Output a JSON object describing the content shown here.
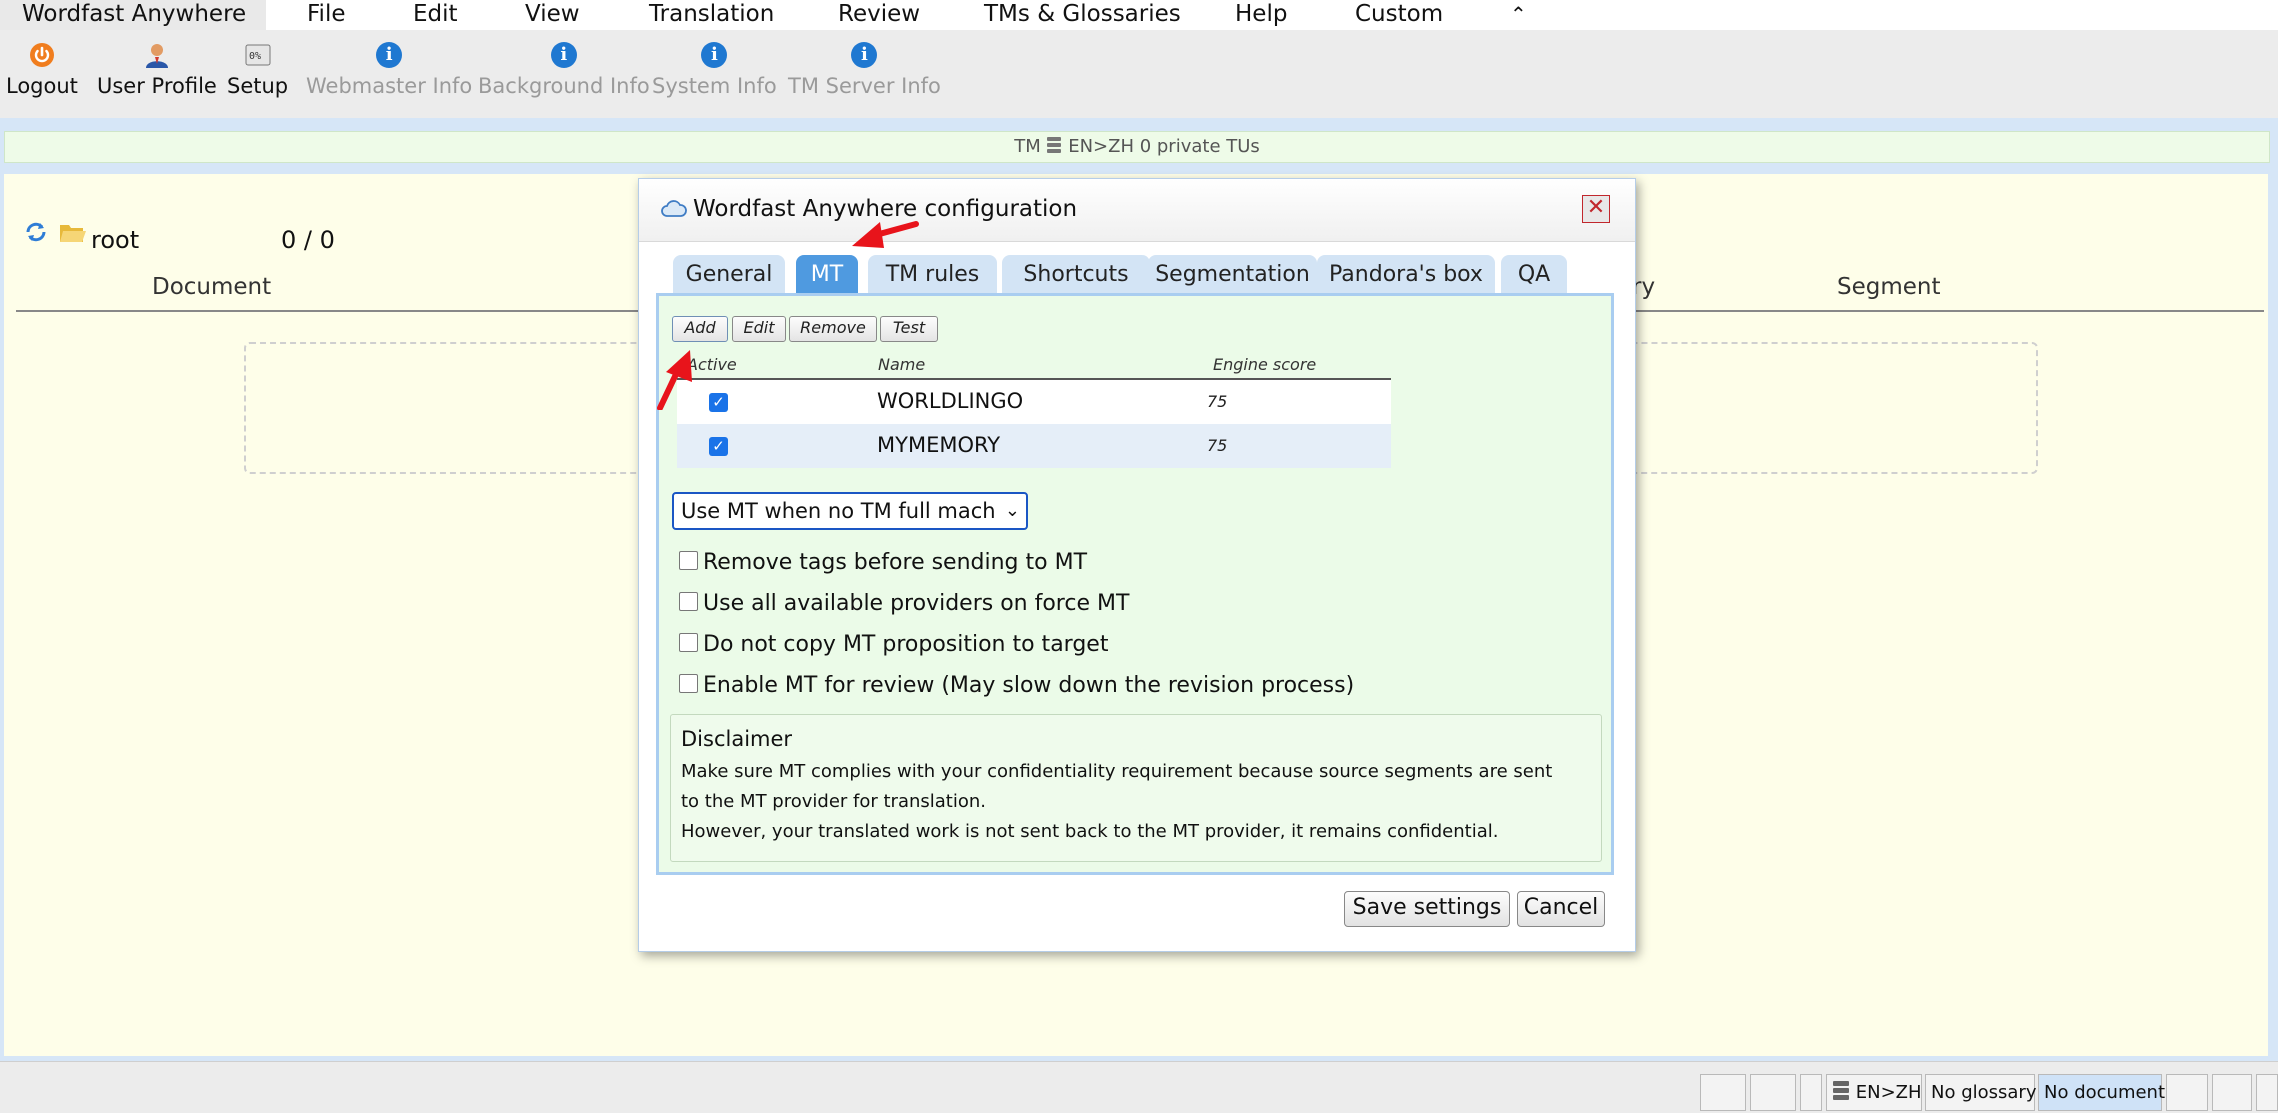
{
  "menubar": {
    "app_name": "Wordfast Anywhere",
    "items": [
      "File",
      "Edit",
      "View",
      "Translation",
      "Review",
      "TMs & Glossaries",
      "Help",
      "Custom"
    ],
    "collapse_icon": "double-chevron-up-icon"
  },
  "toolbar": {
    "items": [
      {
        "label": "Logout",
        "icon": "power-icon",
        "enabled": true
      },
      {
        "label": "User Profile",
        "icon": "user-icon",
        "enabled": true
      },
      {
        "label": "Setup",
        "icon": "setup-icon",
        "enabled": true
      },
      {
        "label": "Webmaster Info",
        "icon": "info-icon",
        "enabled": false
      },
      {
        "label": "Background Info",
        "icon": "info-icon",
        "enabled": false
      },
      {
        "label": "System Info",
        "icon": "info-icon",
        "enabled": false
      },
      {
        "label": "TM Server Info",
        "icon": "info-icon",
        "enabled": false
      }
    ]
  },
  "tmbar": {
    "prefix": "TM",
    "text": "EN>ZH 0 private TUs"
  },
  "main": {
    "root_label": "root",
    "counter": "0 / 0",
    "columns": {
      "document": "Document",
      "glossary_partial": "ry",
      "segment": "Segment"
    }
  },
  "statusbar": {
    "lang": "EN>ZH",
    "glossary": "No glossary",
    "document": "No document"
  },
  "dialog": {
    "title": "Wordfast Anywhere configuration",
    "tabs": [
      "General",
      "MT",
      "TM rules",
      "Shortcuts",
      "Segmentation",
      "Pandora's box",
      "QA"
    ],
    "active_tab": "MT",
    "mt": {
      "buttons": {
        "add": "Add",
        "edit": "Edit",
        "remove": "Remove",
        "test": "Test"
      },
      "table": {
        "headers": {
          "active": "Active",
          "name": "Name",
          "score": "Engine score"
        },
        "rows": [
          {
            "active": true,
            "name": "WORLDLINGO",
            "score": "75"
          },
          {
            "active": true,
            "name": "MYMEMORY",
            "score": "75"
          }
        ]
      },
      "mode_select": "Use MT when no TM full mach",
      "options": [
        {
          "label": "Remove tags before sending to MT",
          "checked": false
        },
        {
          "label": "Use all available providers on force MT",
          "checked": false
        },
        {
          "label": "Do not copy MT proposition to target",
          "checked": false
        },
        {
          "label": "Enable MT for review (May slow down the revision process)",
          "checked": false
        }
      ],
      "disclaimer": {
        "title": "Disclaimer",
        "lines": [
          "Make sure MT complies with your confidentiality requirement because source segments are sent",
          "to the MT provider for translation.",
          "However, your translated work is not sent back to the MT provider, it remains confidential."
        ]
      }
    },
    "save_label": "Save settings",
    "cancel_label": "Cancel"
  },
  "colors": {
    "accent_blue": "#4f9ae0",
    "tab_inactive": "#d3e4f5",
    "panel_green": "#ebfbe8",
    "main_cream": "#fefee9",
    "annotation_red": "#e8141b"
  }
}
